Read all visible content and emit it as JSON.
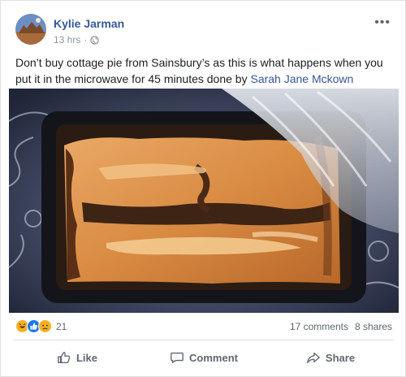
{
  "post": {
    "author": "Kylie Jarman",
    "time": "13 hrs",
    "separator": "·",
    "more": "•••",
    "text_before": "Don’t buy cottage pie from Sainsbury’s as this is what happens when you put it in the microwave for 45 minutes done by ",
    "mention": "Sarah Jane Mckown"
  },
  "stats": {
    "reaction_count": "21",
    "comments": "17 comments",
    "shares": "8 shares"
  },
  "actions": {
    "like": "Like",
    "comment": "Comment",
    "share": "Share"
  },
  "colors": {
    "link_blue": "#365899",
    "meta_grey": "#90949c",
    "action_grey": "#606770"
  }
}
